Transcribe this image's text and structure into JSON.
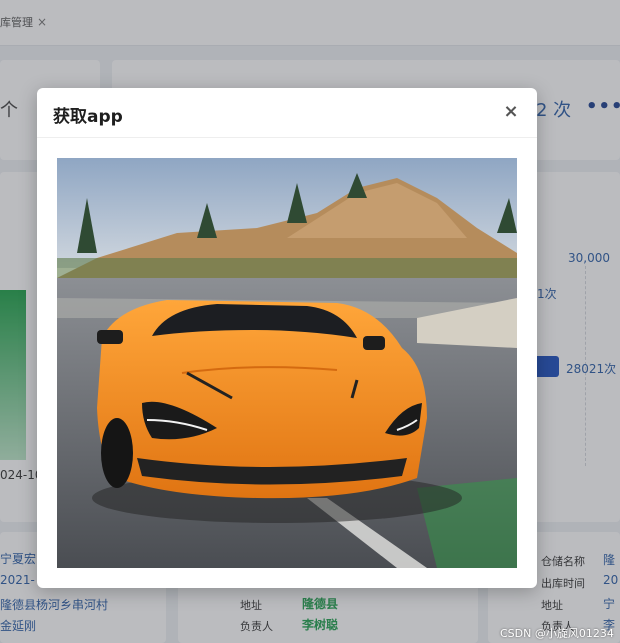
{
  "background": {
    "tab_label": "库管理",
    "stat_left": "个",
    "stat_right": "2 次",
    "chart": {
      "axis_value": "30,000",
      "label_1": "1次",
      "label_2": "28021次",
      "date_label": "024-10"
    },
    "info_left": {
      "line1": "宁夏宏",
      "line2": "2021-",
      "line3": "隆德县杨河乡串河村",
      "line4": "金延刚"
    },
    "info_mid": {
      "address_label": "地址",
      "address_value": "隆德县",
      "owner_label": "负责人",
      "owner_value": "李树聪"
    },
    "info_right": {
      "warehouse_label": "仓储名称",
      "warehouse_value": "隆",
      "outbound_label": "出库时间",
      "outbound_value": "20",
      "address_label": "地址",
      "address_value": "宁",
      "owner_label": "负责人",
      "owner_value": "李"
    },
    "watermark": "CSDN @小旋风01234"
  },
  "modal": {
    "title": "获取app",
    "close_symbol": "×"
  },
  "colors": {
    "car_body": "#f58a1f",
    "accent_blue": "#2c5fa8",
    "accent_green": "#23a150"
  },
  "icons": {
    "close": "close-icon",
    "more": "more-icon"
  }
}
